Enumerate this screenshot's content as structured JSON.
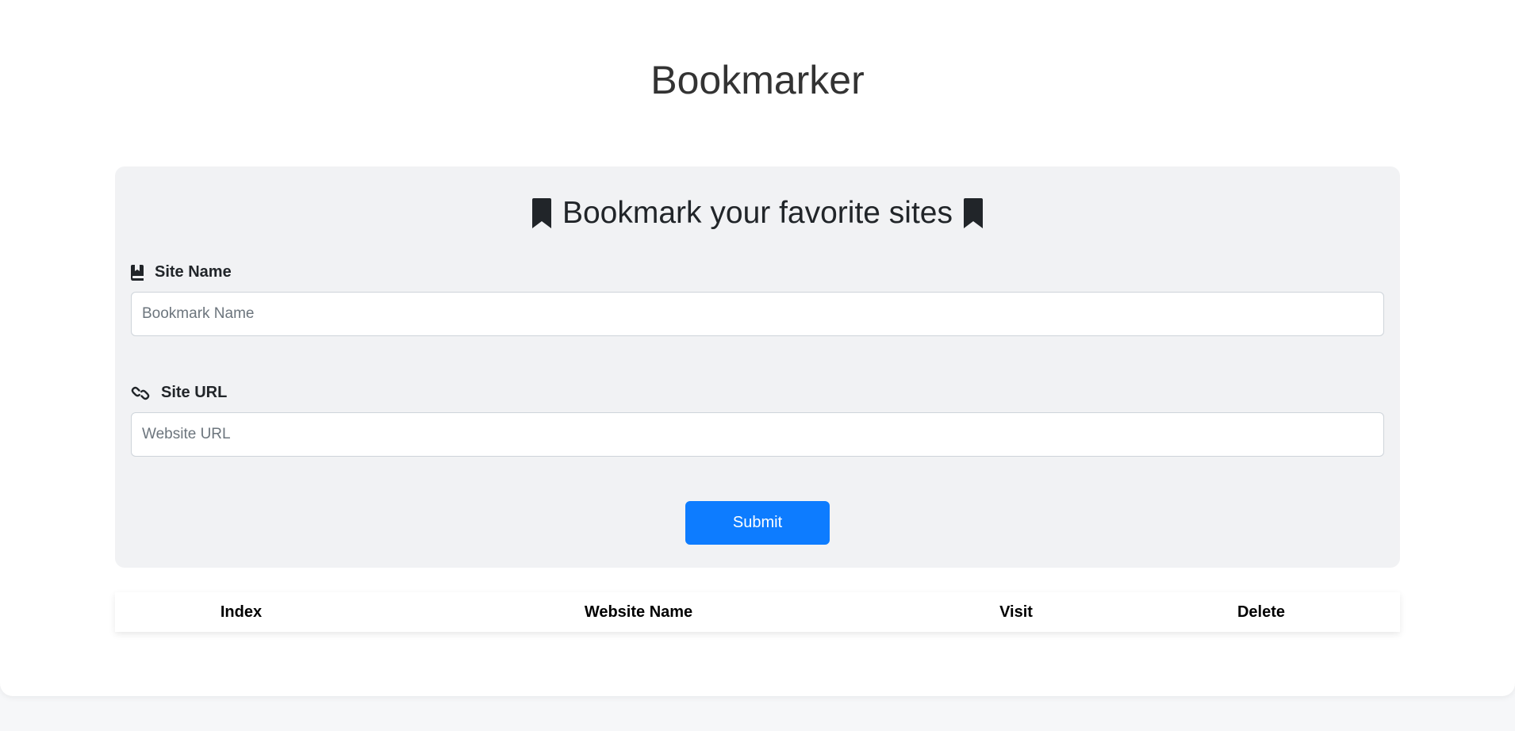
{
  "app": {
    "title": "Bookmarker"
  },
  "form": {
    "heading": "Bookmark your favorite sites",
    "site_name": {
      "label": "Site Name",
      "placeholder": "Bookmark Name",
      "value": "",
      "icon": "book-bookmark-icon"
    },
    "site_url": {
      "label": "Site URL",
      "placeholder": "Website URL",
      "value": "",
      "icon": "link-icon"
    },
    "submit_label": "Submit"
  },
  "table": {
    "columns": [
      "Index",
      "Website Name",
      "Visit",
      "Delete"
    ],
    "rows": []
  },
  "colors": {
    "accent": "#0d7cff",
    "panel_bg": "#f1f2f4",
    "page_bg": "#ffffff"
  }
}
